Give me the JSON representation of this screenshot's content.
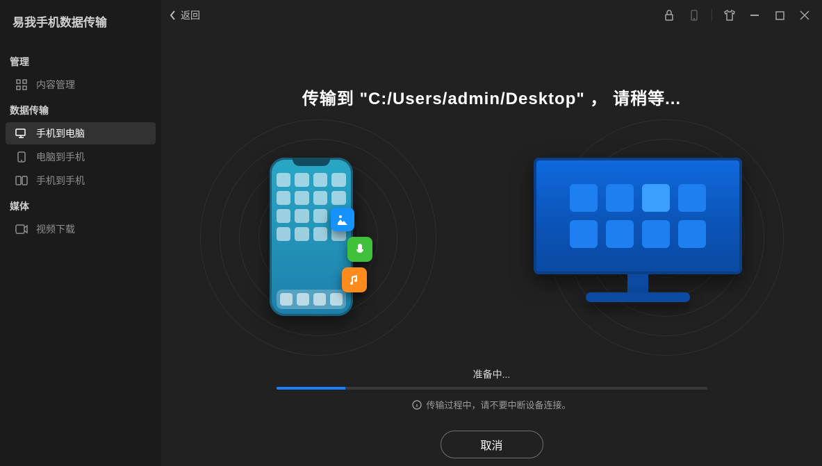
{
  "app_title": "易我手机数据传输",
  "back_label": "返回",
  "sidebar": {
    "sections": [
      {
        "header": "管理",
        "items": [
          {
            "label": "内容管理",
            "icon": "grid-icon",
            "active": false
          }
        ]
      },
      {
        "header": "数据传输",
        "items": [
          {
            "label": "手机到电脑",
            "icon": "phone-to-pc-icon",
            "active": true
          },
          {
            "label": "电脑到手机",
            "icon": "pc-to-phone-icon",
            "active": false
          },
          {
            "label": "手机到手机",
            "icon": "phone-to-phone-icon",
            "active": false
          }
        ]
      },
      {
        "header": "媒体",
        "items": [
          {
            "label": "视频下载",
            "icon": "video-download-icon",
            "active": false
          }
        ]
      }
    ]
  },
  "headline_prefix": "传输到 \"",
  "headline_path": "C:/Users/admin/Desktop",
  "headline_suffix": "\" ， 请稍等...",
  "progress": {
    "status_label": "准备中...",
    "percent": 16,
    "warning": "传输过程中，请不要中断设备连接。"
  },
  "cancel_label": "取消"
}
